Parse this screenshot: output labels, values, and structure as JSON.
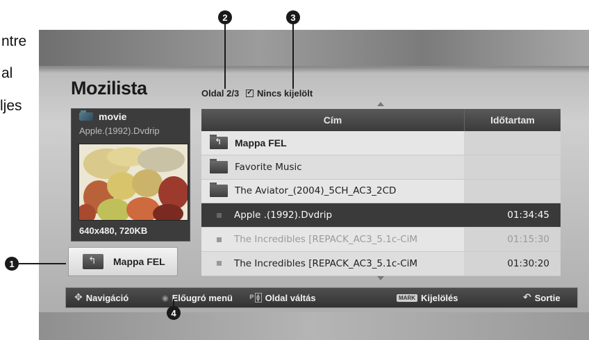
{
  "side_text": [
    "ntre",
    "al",
    "ljes"
  ],
  "markers": [
    "1",
    "2",
    "3",
    "4"
  ],
  "header": {
    "title": "Mozilista",
    "page_indicator": "Oldal 2/3",
    "mark_status": "Nincs kijelölt"
  },
  "preview": {
    "folder_name": "movie",
    "file_name": "Apple.(1992).Dvdrip",
    "file_info": "640x480, 720KB",
    "thumbnail": "fruit-basket-image"
  },
  "up_button": {
    "label": "Mappa FEL",
    "icon": "folder-up-icon"
  },
  "list": {
    "columns": {
      "title": "Cím",
      "duration": "Időtartam"
    },
    "rows": [
      {
        "type": "folder-up",
        "name": "Mappa FEL",
        "duration": ""
      },
      {
        "type": "folder",
        "name": "Favorite Music",
        "duration": ""
      },
      {
        "type": "folder",
        "name": "The Aviator_(2004)_5CH_AC3_2CD",
        "duration": ""
      },
      {
        "type": "file",
        "name": "Apple .(1992).Dvdrip",
        "duration": "01:34:45",
        "selected": true
      },
      {
        "type": "file",
        "name": "The Incredibles [REPACK_AC3_5.1c-CiM",
        "duration": "01:15:30",
        "dimmed": true
      },
      {
        "type": "file",
        "name": "The Incredibles [REPACK_AC3_5.1c-CiM",
        "duration": "01:30:20"
      }
    ]
  },
  "nav_bar": {
    "navigation": "Navigáció",
    "popup_menu": "Előugró menü",
    "page_change_key": "P",
    "page_change": "Oldal váltás",
    "mark_key": "MARK",
    "mark": "Kijelölés",
    "exit": "Sortie"
  },
  "colors": {
    "selected_row": "#3a3a3a",
    "header_bg": "#4a4a4a",
    "nav_bar_bg": "#3e3e3e"
  }
}
